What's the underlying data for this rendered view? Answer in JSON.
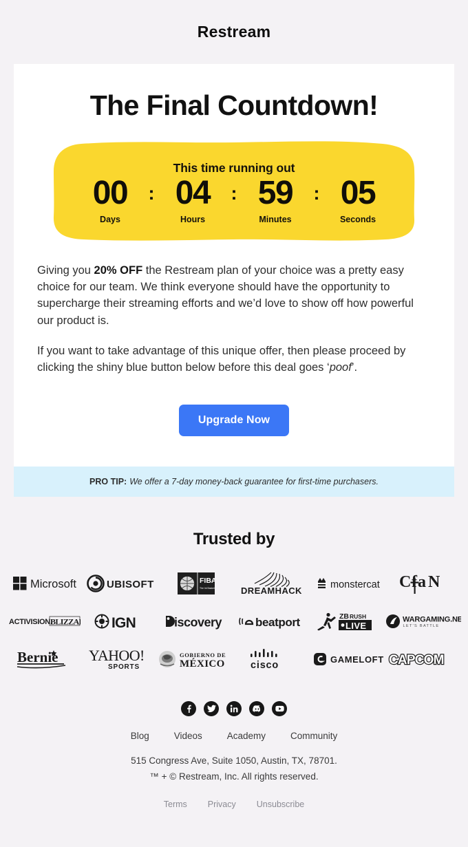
{
  "brand": {
    "name": "Restream"
  },
  "hero": {
    "headline": "The Final Countdown!"
  },
  "countdown": {
    "title": "This time running out",
    "separator": ":",
    "bg_color": "#fad72e",
    "units": [
      {
        "value": "00",
        "label": "Days"
      },
      {
        "value": "04",
        "label": "Hours"
      },
      {
        "value": "59",
        "label": "Minutes"
      },
      {
        "value": "05",
        "label": "Seconds"
      }
    ]
  },
  "body": {
    "p1_a": "Giving you ",
    "p1_strong": "20% OFF",
    "p1_b": " the Restream plan of your choice was a pretty easy choice for our team. We think everyone should have the opportunity to supercharge their streaming efforts and we’d love to show off how powerful our product is.",
    "p2_a": "If you want to take advantage of this unique offer, then please proceed by clicking the shiny blue button below before this deal goes ‘",
    "p2_em": "poof",
    "p2_b": "’."
  },
  "cta": {
    "label": "Upgrade Now",
    "color": "#3b77f6"
  },
  "protip": {
    "label": "PRO TIP:",
    "text": "We offer a 7-day money-back guarantee for first-time purchasers.",
    "bg_color": "#d8f1fc"
  },
  "trusted": {
    "heading": "Trusted by",
    "rows": [
      [
        {
          "name": "Microsoft",
          "icon": "microsoft-logo"
        },
        {
          "name": "UBISOFT",
          "icon": "ubisoft-logo"
        },
        {
          "name": "FIBA",
          "icon": "fiba-logo"
        },
        {
          "name": "DREAMHACK",
          "icon": "dreamhack-logo"
        },
        {
          "name": "monstercat",
          "icon": "monstercat-logo"
        },
        {
          "name": "CfaN",
          "icon": "cfan-logo"
        }
      ],
      [
        {
          "name": "ACTIVISION BLIZZARD",
          "icon": "activision-blizzard-logo"
        },
        {
          "name": "IGN",
          "icon": "ign-logo"
        },
        {
          "name": "Discovery",
          "icon": "discovery-logo"
        },
        {
          "name": "beatport",
          "icon": "beatport-logo"
        },
        {
          "name": "ZBrush LIVE",
          "icon": "zbrush-live-logo"
        },
        {
          "name": "WARGAMING.NET LET'S BATTLE",
          "icon": "wargaming-logo"
        }
      ],
      [
        {
          "name": "Bernie",
          "icon": "bernie-logo"
        },
        {
          "name": "YAHOO! SPORTS",
          "icon": "yahoo-sports-logo"
        },
        {
          "name": "GOBIERNO DE MÉXICO",
          "icon": "gobierno-de-mexico-logo"
        },
        {
          "name": "CISCO",
          "icon": "cisco-logo"
        },
        {
          "name": "GAMELOFT",
          "icon": "gameloft-logo"
        },
        {
          "name": "CAPCOM",
          "icon": "capcom-logo"
        }
      ]
    ]
  },
  "footer": {
    "social": [
      {
        "name": "facebook-icon"
      },
      {
        "name": "twitter-icon"
      },
      {
        "name": "linkedin-icon"
      },
      {
        "name": "discord-icon"
      },
      {
        "name": "youtube-icon"
      }
    ],
    "nav": [
      {
        "label": "Blog"
      },
      {
        "label": "Videos"
      },
      {
        "label": "Academy"
      },
      {
        "label": "Community"
      }
    ],
    "address_line1": "515 Congress Ave, Suite 1050, Austin, TX, 78701.",
    "address_line2": "™ + © Restream, Inc. All rights reserved.",
    "legal": [
      {
        "label": "Terms"
      },
      {
        "label": "Privacy"
      },
      {
        "label": "Unsubscribe"
      }
    ]
  }
}
